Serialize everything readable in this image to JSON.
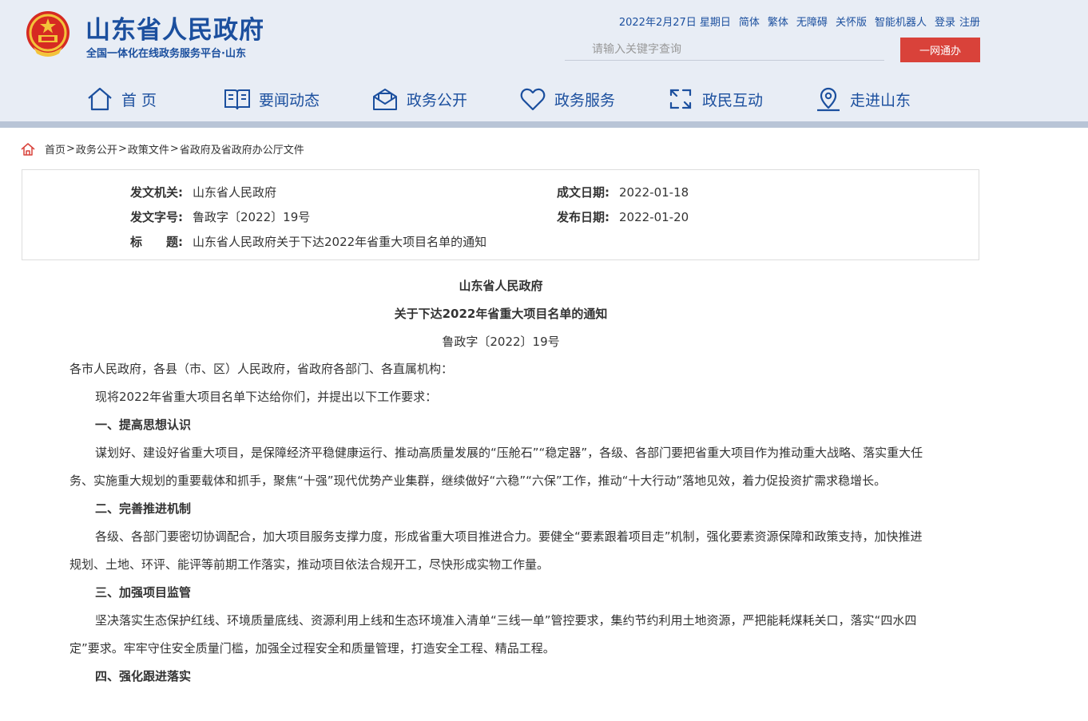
{
  "site": {
    "title": "山东省人民政府",
    "subtitle": "全国一体化在线政务服务平台·山东",
    "colors": {
      "brand": "#1b4f9e",
      "accent": "#d9423a"
    }
  },
  "topbar": {
    "date": "2022年2月27日 星期日",
    "links": [
      "简体",
      "繁体",
      "无障碍",
      "关怀版",
      "智能机器人",
      "登录",
      "注册"
    ]
  },
  "search": {
    "placeholder": "请输入关键字查询",
    "button_label": "一网通办"
  },
  "nav": {
    "items": [
      {
        "label": "首 页",
        "icon": "home-icon"
      },
      {
        "label": "要闻动态",
        "icon": "book-icon"
      },
      {
        "label": "政务公开",
        "icon": "mail-icon"
      },
      {
        "label": "政务服务",
        "icon": "heart-icon"
      },
      {
        "label": "政民互动",
        "icon": "interaction-icon"
      },
      {
        "label": "走进山东",
        "icon": "location-pin-icon"
      }
    ]
  },
  "breadcrumb": {
    "items": [
      "首页",
      "政务公开",
      "政策文件",
      "省政府及省政府办公厅文件"
    ],
    "separator": ">"
  },
  "meta": {
    "issuer_label": "发文机关:",
    "issuer": "山东省人民政府",
    "doc_number_label": "发文字号:",
    "doc_number": "鲁政字〔2022〕19号",
    "title_label": "标　　题:",
    "title": "山东省人民政府关于下达2022年省重大项目名单的通知",
    "created_label": "成文日期:",
    "created": "2022-01-18",
    "published_label": "发布日期:",
    "published": "2022-01-20"
  },
  "document": {
    "heading1": "山东省人民政府",
    "heading2": "关于下达2022年省重大项目名单的通知",
    "number": "鲁政字〔2022〕19号",
    "salutation": "各市人民政府，各县（市、区）人民政府，省政府各部门、各直属机构：",
    "intro": "现将2022年省重大项目名单下达给你们，并提出以下工作要求：",
    "section1_title": "一、提高思想认识",
    "section1_body": "谋划好、建设好省重大项目，是保障经济平稳健康运行、推动高质量发展的“压舱石”“稳定器”，各级、各部门要把省重大项目作为推动重大战略、落实重大任务、实施重大规划的重要载体和抓手，聚焦“十强”现代优势产业集群，继续做好“六稳”“六保”工作，推动“十大行动”落地见效，着力促投资扩需求稳增长。",
    "section2_title": "二、完善推进机制",
    "section2_body": "各级、各部门要密切协调配合，加大项目服务支撑力度，形成省重大项目推进合力。要健全“要素跟着项目走”机制，强化要素资源保障和政策支持，加快推进规划、土地、环评、能评等前期工作落实，推动项目依法合规开工，尽快形成实物工作量。",
    "section3_title": "三、加强项目监管",
    "section3_body": "坚决落实生态保护红线、环境质量底线、资源利用上线和生态环境准入清单“三线一单”管控要求，集约节约利用土地资源，严把能耗煤耗关口，落实“四水四定”要求。牢牢守住安全质量门槛，加强全过程安全和质量管理，打造安全工程、精品工程。",
    "section4_title": "四、强化跟进落实"
  }
}
